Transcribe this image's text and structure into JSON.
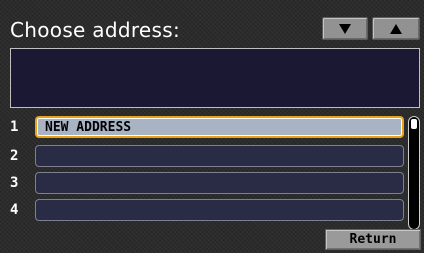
{
  "screen": {
    "title": "Choose address:",
    "scroll_up_icon": "up-triangle-icon",
    "scroll_down_icon": "down-triangle-icon"
  },
  "info_box": {
    "text": ""
  },
  "list": {
    "items": [
      {
        "number": "1",
        "label": "NEW ADDRESS",
        "selected": true
      },
      {
        "number": "2",
        "label": "",
        "selected": false
      },
      {
        "number": "3",
        "label": "",
        "selected": false
      },
      {
        "number": "4",
        "label": "",
        "selected": false
      }
    ]
  },
  "footer": {
    "return_label": "Return"
  },
  "colors": {
    "background": "#2b2b2b",
    "info_box": "#1b1833",
    "row_empty": "#2a2c46",
    "row_selected": "#a8b3c4",
    "selection_border": "#e7a319",
    "button": "#9a9a9a"
  }
}
